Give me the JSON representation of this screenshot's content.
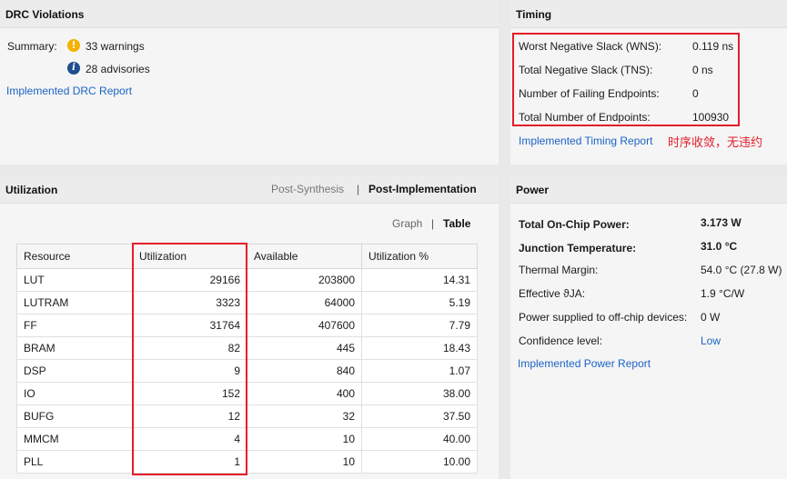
{
  "drc": {
    "title": "DRC Violations",
    "summary_label": "Summary:",
    "warnings": "33 warnings",
    "advisories": "28 advisories",
    "report_link": "Implemented DRC Report",
    "warn_icon_glyph": "!",
    "info_icon_glyph": "i"
  },
  "timing": {
    "title": "Timing",
    "rows": [
      {
        "label": "Worst Negative Slack (WNS):",
        "value": "0.119 ns"
      },
      {
        "label": "Total Negative Slack (TNS):",
        "value": "0 ns"
      },
      {
        "label": "Number of Failing Endpoints:",
        "value": "0"
      },
      {
        "label": "Total Number of Endpoints:",
        "value": "100930"
      }
    ],
    "report_link": "Implemented Timing Report",
    "note": "时序收敛，无违约"
  },
  "utilization": {
    "title": "Utilization",
    "tabs": [
      "Post-Synthesis",
      "Post-Implementation"
    ],
    "tab_separator": "|",
    "view_options": [
      "Graph",
      "Table"
    ],
    "view_separator": "|",
    "columns": [
      "Resource",
      "Utilization",
      "Available",
      "Utilization %"
    ],
    "rows": [
      [
        "LUT",
        "29166",
        "203800",
        "14.31"
      ],
      [
        "LUTRAM",
        "3323",
        "64000",
        "5.19"
      ],
      [
        "FF",
        "31764",
        "407600",
        "7.79"
      ],
      [
        "BRAM",
        "82",
        "445",
        "18.43"
      ],
      [
        "DSP",
        "9",
        "840",
        "1.07"
      ],
      [
        "IO",
        "152",
        "400",
        "38.00"
      ],
      [
        "BUFG",
        "12",
        "32",
        "37.50"
      ],
      [
        "MMCM",
        "4",
        "10",
        "40.00"
      ],
      [
        "PLL",
        "1",
        "10",
        "10.00"
      ]
    ]
  },
  "power": {
    "title": "Power",
    "rows": [
      {
        "label": "Total On-Chip Power:",
        "value": "3.173 W",
        "bold": true
      },
      {
        "label": "Junction Temperature:",
        "value": "31.0 °C",
        "bold": true
      },
      {
        "label": "Thermal Margin:",
        "value": "54.0 °C (27.8 W)",
        "bold": false
      },
      {
        "label": "Effective ϑJA:",
        "value": "1.9 °C/W",
        "bold": false
      },
      {
        "label": "Power supplied to off-chip devices:",
        "value": "0 W",
        "bold": false
      },
      {
        "label": "Confidence level:",
        "value": "Low",
        "bold": false,
        "link": true
      }
    ],
    "report_link": "Implemented Power Report"
  },
  "colors": {
    "link": "#1c62c6",
    "highlight_box": "#e41d2a",
    "warning": "#f3b300",
    "info": "#1e4f8f"
  }
}
